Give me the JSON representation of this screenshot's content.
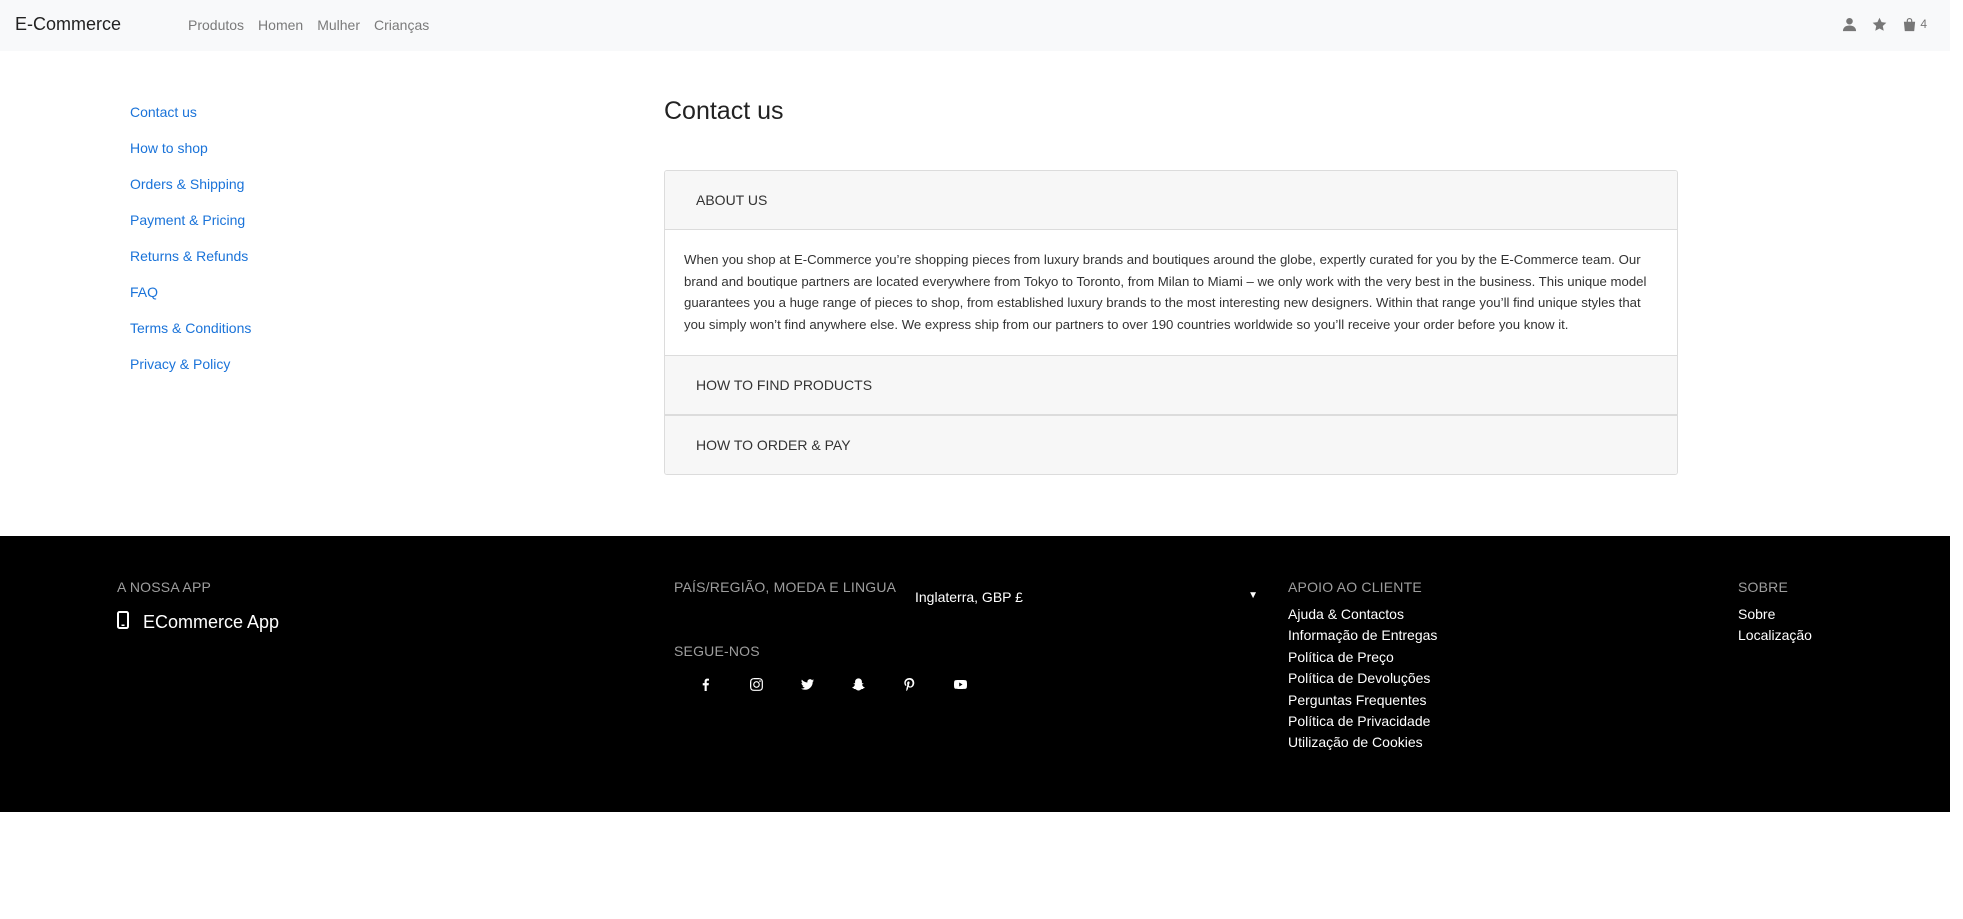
{
  "navbar": {
    "brand": "E-Commerce",
    "links": [
      "Produtos",
      "Homen",
      "Mulher",
      "Crianças"
    ],
    "cart_count": "4",
    "icons": [
      "user-icon",
      "star-icon",
      "shopping-bag-icon"
    ]
  },
  "sidebar": {
    "items": [
      {
        "label": "Contact us"
      },
      {
        "label": "How to shop"
      },
      {
        "label": "Orders & Shipping"
      },
      {
        "label": "Payment & Pricing"
      },
      {
        "label": "Returns & Refunds"
      },
      {
        "label": "FAQ"
      },
      {
        "label": "Terms & Conditions"
      },
      {
        "label": "Privacy & Policy"
      }
    ]
  },
  "main": {
    "title": "Contact us",
    "accordion": [
      {
        "header": "ABOUT US",
        "expanded": true,
        "body": "When you shop at E-Commerce you’re shopping pieces from luxury brands and boutiques around the globe, expertly curated for you by the E-Commerce team. Our brand and boutique partners are located everywhere from Tokyo to Toronto, from Milan to Miami – we only work with the very best in the business. This unique model guarantees you a huge range of pieces to shop, from established luxury brands to the most interesting new designers. Within that range you’ll find unique styles that you simply won’t find anywhere else. We express ship from our partners to over 190 countries worldwide so you’ll receive your order before you know it."
      },
      {
        "header": "HOW TO FIND PRODUCTS",
        "expanded": false
      },
      {
        "header": "HOW TO ORDER & PAY",
        "expanded": false
      }
    ]
  },
  "footer": {
    "app": {
      "heading": "A NOSSA APP",
      "label": "ECommerce App",
      "icon": "mobile-phone-icon"
    },
    "region": {
      "heading": "PAÍS/REGIÃO, MOEDA E LINGUA",
      "selected": "Inglaterra, GBP £"
    },
    "social": {
      "heading": "SEGUE-NOS",
      "icons": [
        "facebook-icon",
        "instagram-icon",
        "twitter-icon",
        "snapchat-icon",
        "pinterest-icon",
        "youtube-icon"
      ]
    },
    "support": {
      "heading": "APOIO AO CLIENTE",
      "links": [
        "Ajuda & Contactos",
        "Informação de Entregas",
        "Política de Preço",
        "Política de Devoluções",
        "Perguntas Frequentes",
        "Política de Privacidade",
        "Utilização de Cookies"
      ]
    },
    "about": {
      "heading": "SOBRE",
      "links": [
        "Sobre",
        "Localização"
      ]
    }
  },
  "colors": {
    "link_blue": "#1a73d9",
    "navbar_bg": "#f8f9fa",
    "footer_bg": "#000000",
    "footer_heading": "#9e9e9e",
    "accordion_header_bg": "#f7f7f7"
  }
}
